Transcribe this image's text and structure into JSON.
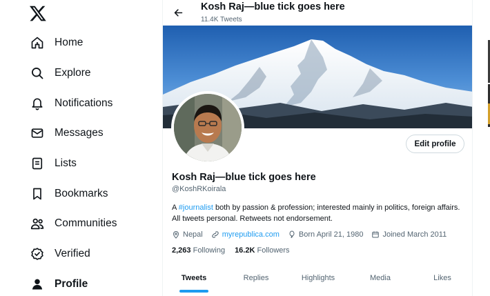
{
  "nav": {
    "logo_icon": "x-logo-icon",
    "items": [
      {
        "label": "Home",
        "icon": "home-icon",
        "active": false
      },
      {
        "label": "Explore",
        "icon": "search-icon",
        "active": false
      },
      {
        "label": "Notifications",
        "icon": "bell-icon",
        "active": false
      },
      {
        "label": "Messages",
        "icon": "envelope-icon",
        "active": false
      },
      {
        "label": "Lists",
        "icon": "list-icon",
        "active": false
      },
      {
        "label": "Bookmarks",
        "icon": "bookmark-icon",
        "active": false
      },
      {
        "label": "Communities",
        "icon": "people-icon",
        "active": false
      },
      {
        "label": "Verified",
        "icon": "verified-badge-icon",
        "active": false
      },
      {
        "label": "Profile",
        "icon": "person-icon",
        "active": true
      }
    ]
  },
  "header": {
    "name": "Kosh Raj—blue tick goes here",
    "tweet_count": "11.4K Tweets"
  },
  "profile": {
    "name": "Kosh Raj—blue tick goes here",
    "handle": "@KoshRKoirala",
    "edit_label": "Edit profile",
    "bio_prefix": "A ",
    "bio_hashtag": "#journalist",
    "bio_suffix": " both by passion & profession; interested mainly in politics, foreign affairs. All tweets personal. Retweets not endorsement.",
    "location": "Nepal",
    "website": "myrepublica.com",
    "born": "Born April 21, 1980",
    "joined": "Joined March 2011",
    "following_count": "2,263",
    "following_label": "Following",
    "followers_count": "16.2K",
    "followers_label": "Followers"
  },
  "tabs": [
    {
      "label": "Tweets",
      "active": true
    },
    {
      "label": "Replies",
      "active": false
    },
    {
      "label": "Highlights",
      "active": false
    },
    {
      "label": "Media",
      "active": false
    },
    {
      "label": "Likes",
      "active": false
    }
  ],
  "colors": {
    "accent": "#1d9bf0",
    "text": "#0f1419",
    "secondary": "#536471"
  }
}
